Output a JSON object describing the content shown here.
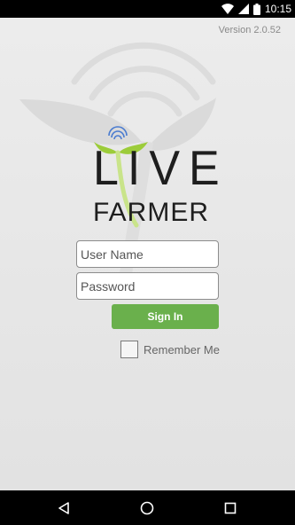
{
  "status_bar": {
    "time": "10:15",
    "icons": [
      "wifi-icon",
      "signal-icon",
      "battery-icon"
    ]
  },
  "app": {
    "version": "Version 2.0.52",
    "logo": {
      "line1": "LIVE",
      "line2": "FARMER"
    }
  },
  "login": {
    "username_placeholder": "User Name",
    "password_placeholder": "Password",
    "signin_label": "Sign In",
    "remember_label": "Remember Me",
    "remember_checked": false
  },
  "nav_bar": {
    "icons": [
      "back-icon",
      "home-icon",
      "recents-icon"
    ]
  },
  "colors": {
    "accent_green": "#6ab04c",
    "leaf_green": "#9ccc3a",
    "signal_blue": "#4a7bd0"
  }
}
